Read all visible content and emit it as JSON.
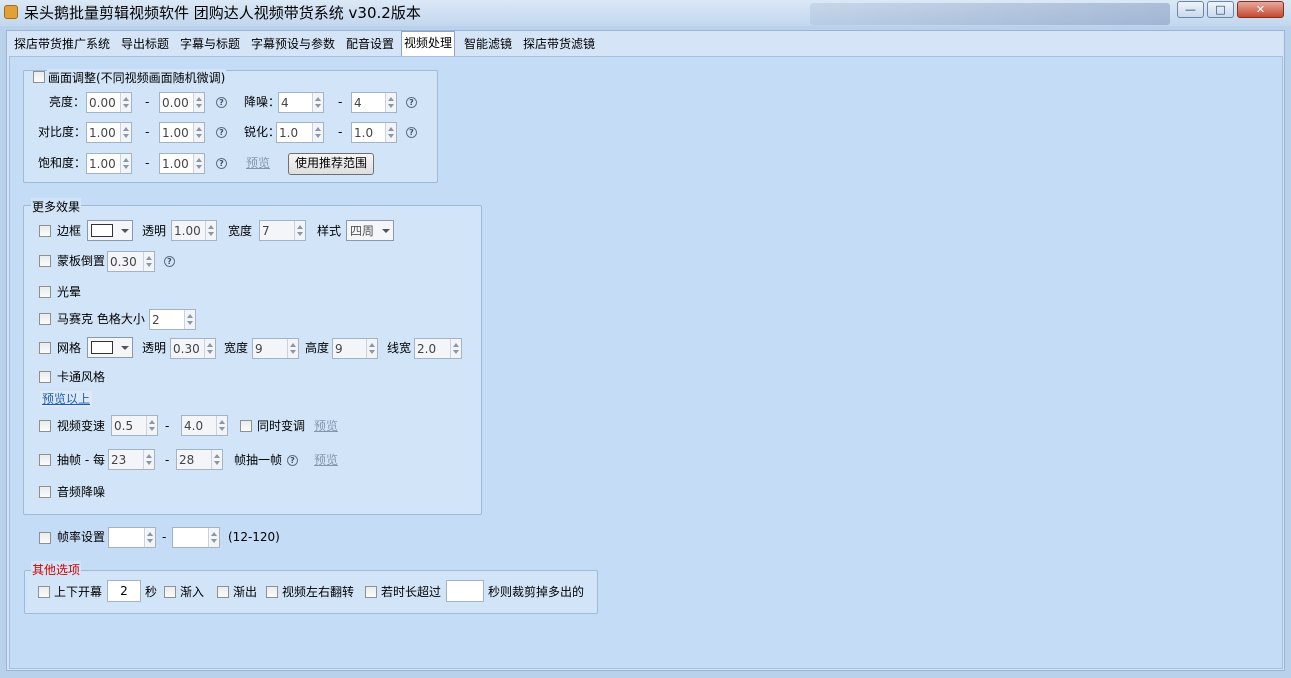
{
  "window": {
    "title": "呆头鹅批量剪辑视频软件    团购达人视频带货系统   v30.2版本",
    "min": "—",
    "max": "□",
    "close": "✕"
  },
  "tabs": [
    "探店带货推广系统",
    "导出标题",
    "字幕与标题",
    "字幕预设与参数",
    "配音设置",
    "视频处理",
    "智能滤镜",
    "探店带货滤镜"
  ],
  "active_tab": "视频处理",
  "picture_adjust": {
    "title": "画面调整(不同视频画面随机微调)",
    "brightness_label": "亮度：",
    "brightness_min": "0.00",
    "brightness_max": "0.00",
    "denoise_label": "降噪：",
    "denoise_min": "4",
    "denoise_max": "4",
    "contrast_label": "对比度：",
    "contrast_min": "1.00",
    "contrast_max": "1.00",
    "sharpen_label": "锐化：",
    "sharpen_min": "1.0",
    "sharpen_max": "1.0",
    "saturation_label": "饱和度：",
    "saturation_min": "1.00",
    "saturation_max": "1.00",
    "preview": "预览",
    "recommend_btn": "使用推荐范围",
    "dash": "-",
    "help": "?"
  },
  "more_effects": {
    "title": "更多效果",
    "border_label": "边框",
    "border_opacity_label": "透明",
    "border_opacity": "1.00",
    "border_width_label": "宽度",
    "border_width": "7",
    "border_style_label": "样式",
    "border_style": "四周",
    "mask_label": "蒙板倒置",
    "mask_value": "0.30",
    "glow_label": "光晕",
    "mosaic_label": "马赛克 色格大小",
    "mosaic_size": "2",
    "grid_label": "网格",
    "grid_opacity_label": "透明",
    "grid_opacity": "0.30",
    "grid_width_label": "宽度",
    "grid_width": "9",
    "grid_height_label": "高度",
    "grid_height": "9",
    "grid_line_label": "线宽",
    "grid_line": "2.0",
    "cartoon_label": "卡通风格",
    "preview_above": "预览以上",
    "speed_label": "视频变速",
    "speed_min": "0.5",
    "speed_max": "4.0",
    "pitch_label": "同时变调",
    "speed_preview": "预览",
    "drop_label": "抽帧 - 每",
    "drop_min": "23",
    "drop_max": "28",
    "drop_suffix": "帧抽一帧",
    "drop_preview": "预览",
    "audio_denoise_label": "音频降噪"
  },
  "frame_rate": {
    "label": "帧率设置",
    "min": "",
    "max": "",
    "range": "(12-120)"
  },
  "other": {
    "title": "其他选项",
    "curtain_label": "上下开幕",
    "curtain_value": "2",
    "seconds": "秒",
    "fade_in": "渐入",
    "fade_out": "渐出",
    "flip": "视频左右翻转",
    "overlength": "若时长超过",
    "overlength_value": "",
    "trim_label": "秒则裁剪掉多出的"
  }
}
